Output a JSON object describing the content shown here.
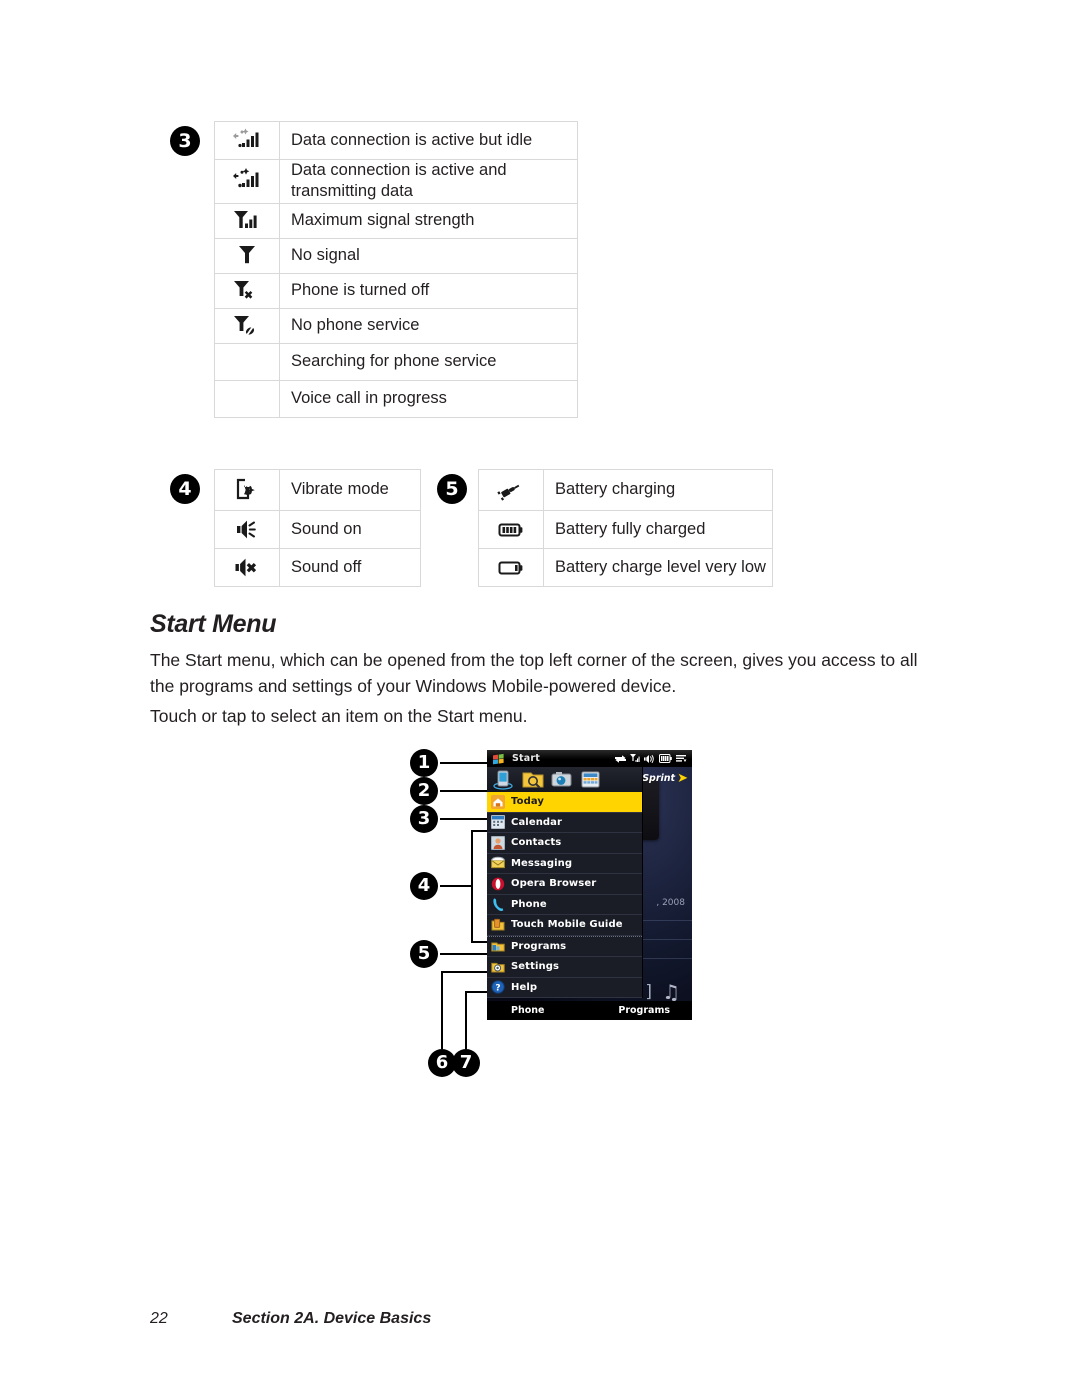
{
  "page": {
    "number": "22",
    "section": "Section 2A. Device Basics"
  },
  "tables": [
    {
      "callout": "3",
      "rows": [
        {
          "icon": "data-connection-idle-icon",
          "text": "Data connection is active but idle"
        },
        {
          "icon": "data-connection-transmitting-icon",
          "text": "Data connection is active and transmitting data"
        },
        {
          "icon": "signal-max-icon",
          "text": "Maximum signal strength"
        },
        {
          "icon": "no-signal-icon",
          "text": "No signal"
        },
        {
          "icon": "phone-off-icon",
          "text": "Phone is turned off"
        },
        {
          "icon": "no-phone-service-icon",
          "text": "No phone service"
        },
        {
          "icon": "",
          "text": "Searching for phone service"
        },
        {
          "icon": "",
          "text": "Voice call in progress"
        }
      ]
    },
    {
      "callout": "4",
      "rows": [
        {
          "icon": "vibrate-icon",
          "text": "Vibrate mode"
        },
        {
          "icon": "sound-on-icon",
          "text": "Sound on"
        },
        {
          "icon": "sound-off-icon",
          "text": "Sound off"
        }
      ]
    },
    {
      "callout": "5",
      "rows": [
        {
          "icon": "battery-charging-icon",
          "text": "Battery charging"
        },
        {
          "icon": "battery-full-icon",
          "text": "Battery fully charged"
        },
        {
          "icon": "battery-low-icon",
          "text": "Battery charge level very low"
        }
      ]
    }
  ],
  "section": {
    "heading": "Start Menu",
    "paragraph1": "The Start menu, which can be opened from the top left corner of the screen, gives you access to all the programs and settings of your Windows Mobile-powered device.",
    "paragraph2": "Touch or tap to select an item on the Start menu."
  },
  "device": {
    "title_bar": {
      "start_label": "Start",
      "logo": "windows-logo-icon",
      "tray_icons": [
        "connectivity-icon",
        "signal-icon",
        "volume-icon",
        "battery-icon",
        "more-icon"
      ]
    },
    "carrier": "Sprint",
    "date_text": ", 2008",
    "recent_icons": [
      "device-sync-icon",
      "file-explorer-icon",
      "camera-icon",
      "calculator-icon"
    ],
    "menu_items": [
      {
        "label": "Today",
        "icon": "today-house-icon",
        "selected": true
      },
      {
        "label": "Calendar",
        "icon": "calendar-icon",
        "selected": false
      },
      {
        "label": "Contacts",
        "icon": "contacts-icon",
        "selected": false
      },
      {
        "label": "Messaging",
        "icon": "messaging-envelope-icon",
        "selected": false
      },
      {
        "label": "Opera Browser",
        "icon": "opera-browser-icon",
        "selected": false
      },
      {
        "label": "Phone",
        "icon": "phone-handset-icon",
        "selected": false
      },
      {
        "label": "Touch Mobile Guide",
        "icon": "guide-book-icon",
        "selected": false
      },
      {
        "label": "Programs",
        "icon": "programs-icon",
        "selected": false
      },
      {
        "label": "Settings",
        "icon": "settings-icon",
        "selected": false
      },
      {
        "label": "Help",
        "icon": "help-question-icon",
        "selected": false
      }
    ],
    "softkeys": {
      "left": "Phone",
      "right": "Programs"
    }
  },
  "callouts": [
    "1",
    "2",
    "3",
    "4",
    "5",
    "6",
    "7"
  ],
  "colors": {
    "selection": "#ffd400",
    "menu_background": "#1b1d26",
    "title_bar": "#000000",
    "table_border": "#d9d9d9",
    "text": "#231f20"
  }
}
